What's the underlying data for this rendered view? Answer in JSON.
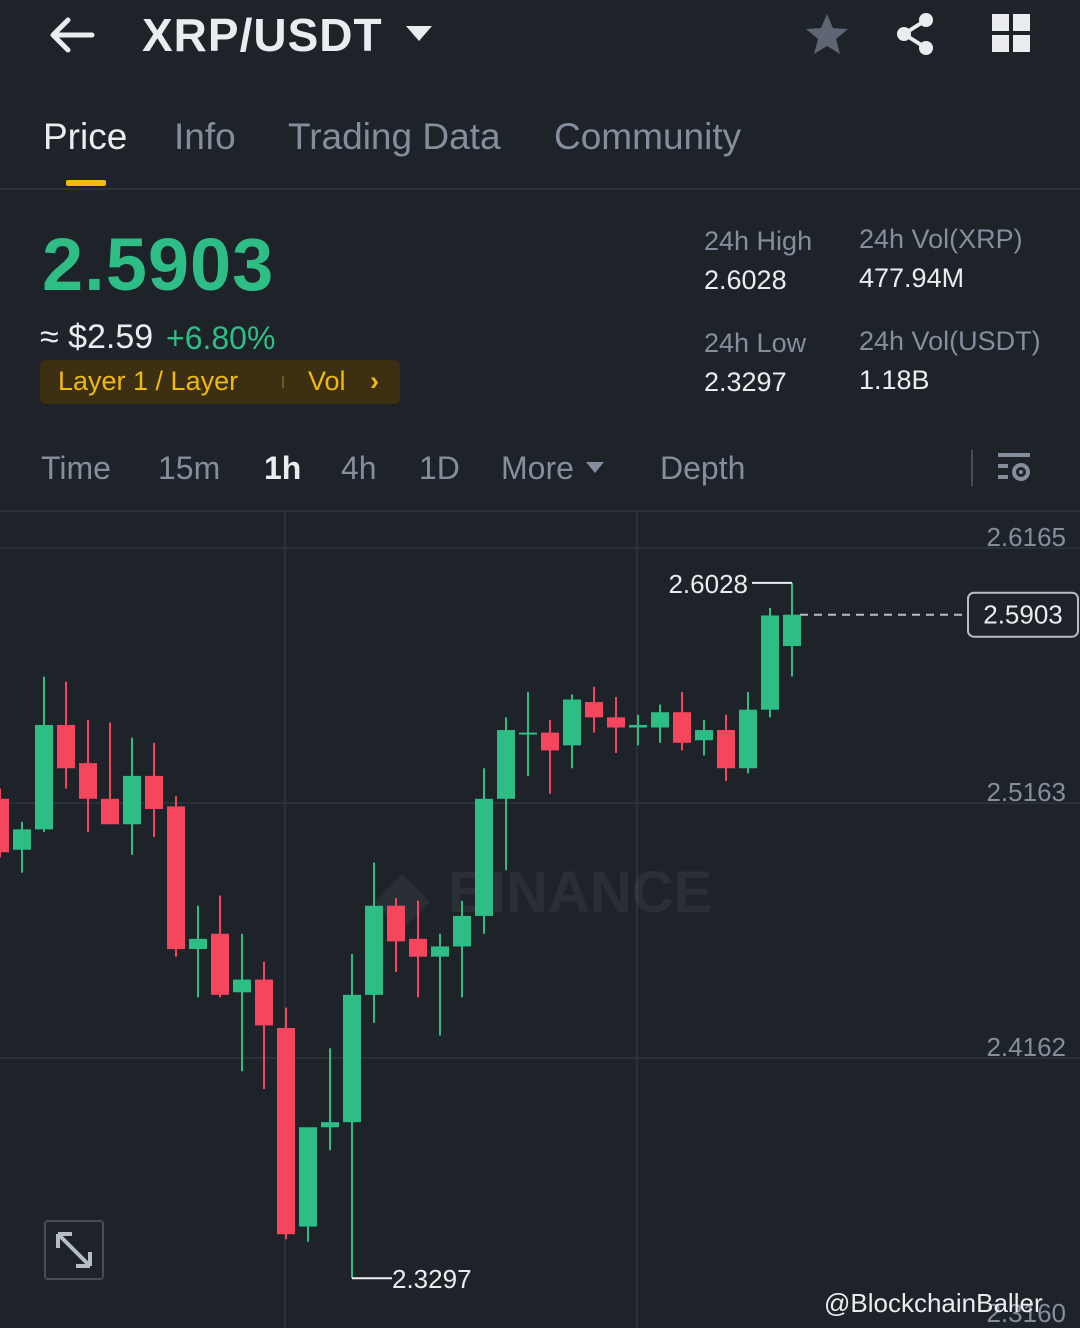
{
  "header": {
    "pair": "XRP/USDT",
    "icons": [
      "back-arrow-icon",
      "caret-down-icon",
      "star-icon",
      "share-icon",
      "grid-icon"
    ]
  },
  "tabs": [
    {
      "label": "Price",
      "active": true
    },
    {
      "label": "Info",
      "active": false
    },
    {
      "label": "Trading Data",
      "active": false
    },
    {
      "label": "Community",
      "active": false
    }
  ],
  "ticker": {
    "price": "2.5903",
    "fiat": "≈ $2.59",
    "change": "+6.80%",
    "tag_label": "Layer 1 / Layer",
    "tag_vol": "Vol",
    "tag_chevron": "›"
  },
  "stats": {
    "high_label": "24h High",
    "high_value": "2.6028",
    "low_label": "24h Low",
    "low_value": "2.3297",
    "vol_base_label": "24h Vol(XRP)",
    "vol_base_value": "477.94M",
    "vol_quote_label": "24h Vol(USDT)",
    "vol_quote_value": "1.18B"
  },
  "intervals": {
    "items": [
      "Time",
      "15m",
      "1h",
      "4h",
      "1D",
      "More",
      "Depth"
    ],
    "active": "1h"
  },
  "colors": {
    "up": "#2ebd85",
    "down": "#f6465d",
    "accent": "#f0b90b",
    "background": "#1e2329"
  },
  "chart_data": {
    "type": "candlestick",
    "axis_ticks": [
      "2.6165",
      "2.5163",
      "2.4162"
    ],
    "y_ticks_values": [
      2.6165,
      2.5163,
      2.4162
    ],
    "high_label": "2.6028",
    "low_label": "2.3297",
    "current_label": "2.5903",
    "current": 2.5903,
    "bottom_tick_partial": "2.3160",
    "candles": [
      {
        "o": 2.518,
        "h": 2.522,
        "l": 2.495,
        "c": 2.497
      },
      {
        "o": 2.498,
        "h": 2.509,
        "l": 2.489,
        "c": 2.506
      },
      {
        "o": 2.506,
        "h": 2.566,
        "l": 2.505,
        "c": 2.547
      },
      {
        "o": 2.547,
        "h": 2.564,
        "l": 2.522,
        "c": 2.53
      },
      {
        "o": 2.532,
        "h": 2.549,
        "l": 2.505,
        "c": 2.518
      },
      {
        "o": 2.518,
        "h": 2.548,
        "l": 2.51,
        "c": 2.508
      },
      {
        "o": 2.508,
        "h": 2.542,
        "l": 2.496,
        "c": 2.527
      },
      {
        "o": 2.527,
        "h": 2.54,
        "l": 2.503,
        "c": 2.514
      },
      {
        "o": 2.515,
        "h": 2.519,
        "l": 2.456,
        "c": 2.459
      },
      {
        "o": 2.459,
        "h": 2.476,
        "l": 2.44,
        "c": 2.463
      },
      {
        "o": 2.465,
        "h": 2.48,
        "l": 2.44,
        "c": 2.441
      },
      {
        "o": 2.442,
        "h": 2.465,
        "l": 2.411,
        "c": 2.447
      },
      {
        "o": 2.447,
        "h": 2.454,
        "l": 2.404,
        "c": 2.429
      },
      {
        "o": 2.428,
        "h": 2.436,
        "l": 2.345,
        "c": 2.347
      },
      {
        "o": 2.35,
        "h": 2.374,
        "l": 2.344,
        "c": 2.389
      },
      {
        "o": 2.389,
        "h": 2.42,
        "l": 2.38,
        "c": 2.391
      },
      {
        "o": 2.391,
        "h": 2.457,
        "l": 2.3297,
        "c": 2.441
      },
      {
        "o": 2.441,
        "h": 2.493,
        "l": 2.43,
        "c": 2.476
      },
      {
        "o": 2.476,
        "h": 2.479,
        "l": 2.45,
        "c": 2.462
      },
      {
        "o": 2.463,
        "h": 2.478,
        "l": 2.44,
        "c": 2.456
      },
      {
        "o": 2.456,
        "h": 2.465,
        "l": 2.425,
        "c": 2.46
      },
      {
        "o": 2.46,
        "h": 2.478,
        "l": 2.44,
        "c": 2.472
      },
      {
        "o": 2.472,
        "h": 2.53,
        "l": 2.465,
        "c": 2.518
      },
      {
        "o": 2.518,
        "h": 2.55,
        "l": 2.49,
        "c": 2.545
      },
      {
        "o": 2.544,
        "h": 2.56,
        "l": 2.527,
        "c": 2.544
      },
      {
        "o": 2.544,
        "h": 2.549,
        "l": 2.52,
        "c": 2.537
      },
      {
        "o": 2.539,
        "h": 2.559,
        "l": 2.53,
        "c": 2.557
      },
      {
        "o": 2.556,
        "h": 2.562,
        "l": 2.544,
        "c": 2.55
      },
      {
        "o": 2.55,
        "h": 2.558,
        "l": 2.536,
        "c": 2.546
      },
      {
        "o": 2.546,
        "h": 2.551,
        "l": 2.539,
        "c": 2.547
      },
      {
        "o": 2.546,
        "h": 2.555,
        "l": 2.54,
        "c": 2.552
      },
      {
        "o": 2.552,
        "h": 2.56,
        "l": 2.537,
        "c": 2.54
      },
      {
        "o": 2.541,
        "h": 2.549,
        "l": 2.535,
        "c": 2.545
      },
      {
        "o": 2.545,
        "h": 2.551,
        "l": 2.525,
        "c": 2.53
      },
      {
        "o": 2.53,
        "h": 2.56,
        "l": 2.528,
        "c": 2.553
      },
      {
        "o": 2.553,
        "h": 2.593,
        "l": 2.55,
        "c": 2.59
      },
      {
        "o": 2.578,
        "h": 2.6028,
        "l": 2.566,
        "c": 2.5903
      }
    ]
  },
  "watermark": "@BlockchainBaller"
}
